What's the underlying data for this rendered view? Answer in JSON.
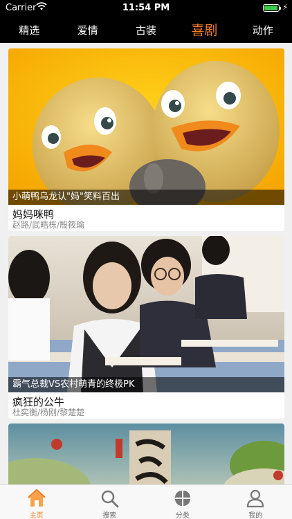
{
  "status": {
    "carrier": "Carrier",
    "time": "11:54 PM"
  },
  "categories": [
    {
      "label": "精选"
    },
    {
      "label": "爱情"
    },
    {
      "label": "古装"
    },
    {
      "label": "喜剧"
    },
    {
      "label": "动作"
    }
  ],
  "active_category": "喜剧",
  "cards": [
    {
      "caption": "小萌鸭乌龙认\"妈\"笑料百出",
      "title": "妈妈咪鸭",
      "cast": "赵路/武皓栋/殷筱瑜",
      "image": "cartoon-ducklings"
    },
    {
      "caption": "霸气总裁VS农村萌青的终极PK",
      "title": "疯狂的公牛",
      "cast": "杜奕衡/杨刚/黎楚楚",
      "image": "classroom-students"
    },
    {
      "caption": "",
      "title": "",
      "cast": "",
      "image": "monster-poster"
    }
  ],
  "tabs": [
    {
      "label": "主页",
      "icon": "home-icon"
    },
    {
      "label": "搜索",
      "icon": "search-icon"
    },
    {
      "label": "分类",
      "icon": "category-icon"
    },
    {
      "label": "我的",
      "icon": "profile-icon"
    }
  ],
  "colors": {
    "accent": "#f47e1f",
    "topbar": "#000000",
    "battery": "#3ecb4c"
  }
}
